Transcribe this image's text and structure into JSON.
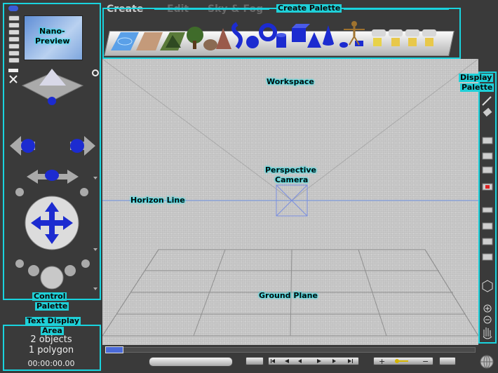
{
  "tabs": {
    "create": "Create",
    "edit": "Edit",
    "sky_fog": "Sky & Fog"
  },
  "callouts": {
    "create_palette": "Create Palette",
    "workspace": "Workspace",
    "display_palette_1": "Display",
    "display_palette_2": "Palette",
    "nano_preview_1": "Nano-",
    "nano_preview_2": "Preview",
    "perspective_camera_1": "Perspective",
    "perspective_camera_2": "Camera",
    "horizon_line": "Horizon Line",
    "ground_plane": "Ground Plane",
    "control_palette_1": "Control",
    "control_palette_2": "Palette",
    "text_display_1": "Text Display",
    "text_display_2": "Area"
  },
  "status": {
    "objects": "2 objects",
    "polygons": "1 polygon",
    "time": "00:00:00.00"
  },
  "colors": {
    "accent": "#19d3de",
    "panel": "#3a3a3a",
    "workspace": "#c9c9c9",
    "horizon": "#6c8fe0",
    "object_blue": "#1c2bd0"
  },
  "create_objects": [
    "water-icon",
    "terrain-icon",
    "mountain-icon",
    "tree-icon",
    "rock-icon",
    "cone-mountain-icon",
    "torus-spiral-icon",
    "sphere-icon",
    "torus-icon",
    "cylinder-icon",
    "cube-icon",
    "pyramid-icon",
    "cone-icon",
    "human-figure-icon",
    "light-icon",
    "light-icon",
    "light-icon",
    "light-icon"
  ]
}
